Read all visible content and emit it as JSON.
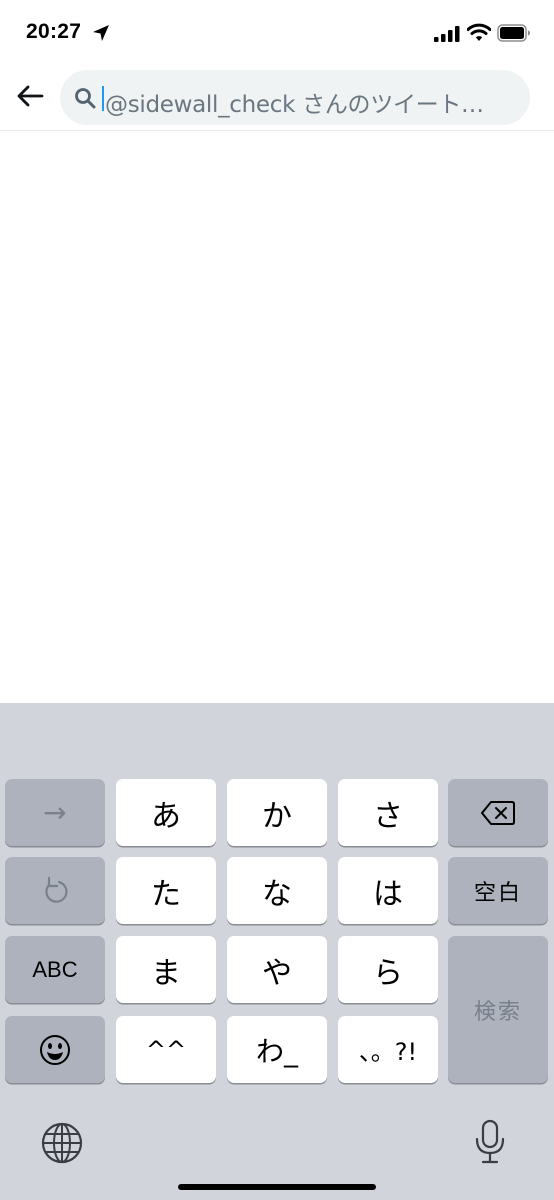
{
  "status_bar": {
    "time": "20:27"
  },
  "header": {
    "search": {
      "placeholder": "@sidewall_check さんのツイート…"
    }
  },
  "keyboard": {
    "rows": [
      [
        "→",
        "あ",
        "か",
        "さ"
      ],
      [
        "た",
        "な",
        "は",
        "空白"
      ],
      [
        "ABC",
        "ま",
        "や",
        "ら",
        "検索"
      ],
      [
        "^^",
        "わ_",
        "、。?!"
      ]
    ],
    "next_key": "→",
    "kana_keys": {
      "a": "あ",
      "ka": "か",
      "sa": "さ",
      "ta": "た",
      "na": "な",
      "ha": "は",
      "ma": "ま",
      "ya": "や",
      "ra": "ら",
      "kaomoji": "^^",
      "wa": "わ_",
      "punct": "、。?!"
    },
    "space": "空白",
    "abc": "ABC",
    "search": "検索"
  },
  "icons": [
    "location-arrow-icon",
    "signal-icon",
    "wifi-icon",
    "battery-icon",
    "back-arrow-icon",
    "search-icon",
    "delete-icon",
    "undo-icon",
    "emoji-icon",
    "globe-icon",
    "microphone-icon"
  ],
  "colors": {
    "accent": "#1d9bf0",
    "keyboard_bg": "#d1d4db",
    "search_bg": "#eff3f4"
  }
}
